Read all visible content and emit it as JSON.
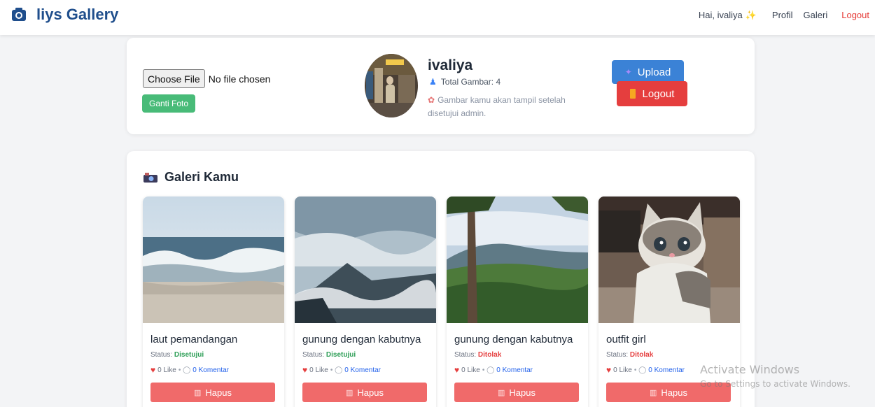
{
  "navbar": {
    "brand": "liys Gallery",
    "greeting": "Hai, ivaliya",
    "greeting_icon": "sparkle-icon",
    "links": [
      "Profil",
      "Galeri",
      "Logout"
    ]
  },
  "profile": {
    "file_button": "Choose File",
    "file_status": "No file chosen",
    "change_photo": "Ganti Foto",
    "username": "ivaliya",
    "total_images": "Total Gambar: 4",
    "note": "Gambar kamu akan tampil setelah disetujui admin.",
    "upload_label": "Upload",
    "logout_label": "Logout"
  },
  "gallery": {
    "title": "Galeri Kamu",
    "status_prefix": "Status:",
    "items": [
      {
        "title": "laut pemandangan",
        "status": "Disetujui",
        "likes": "0 Like",
        "comments": "0 Komentar",
        "delete_label": "Hapus"
      },
      {
        "title": "gunung dengan kabutnya",
        "status": "Disetujui",
        "likes": "0 Like",
        "comments": "0 Komentar",
        "delete_label": "Hapus"
      },
      {
        "title": "gunung dengan kabutnya",
        "status": "Ditolak",
        "likes": "0 Like",
        "comments": "0 Komentar",
        "delete_label": "Hapus"
      },
      {
        "title": "outfit girl",
        "status": "Ditolak",
        "likes": "0 Like",
        "comments": "0 Komentar",
        "delete_label": "Hapus"
      }
    ]
  },
  "watermark": {
    "line1": "Activate Windows",
    "line2": "Go to Settings to activate Windows."
  },
  "colors": {
    "brand": "#1f4e8c",
    "approved": "#2e9e57",
    "rejected": "#e53e3e",
    "upload": "#3b82d6",
    "ganti": "#48bb78",
    "hapus": "#f06a6a"
  }
}
